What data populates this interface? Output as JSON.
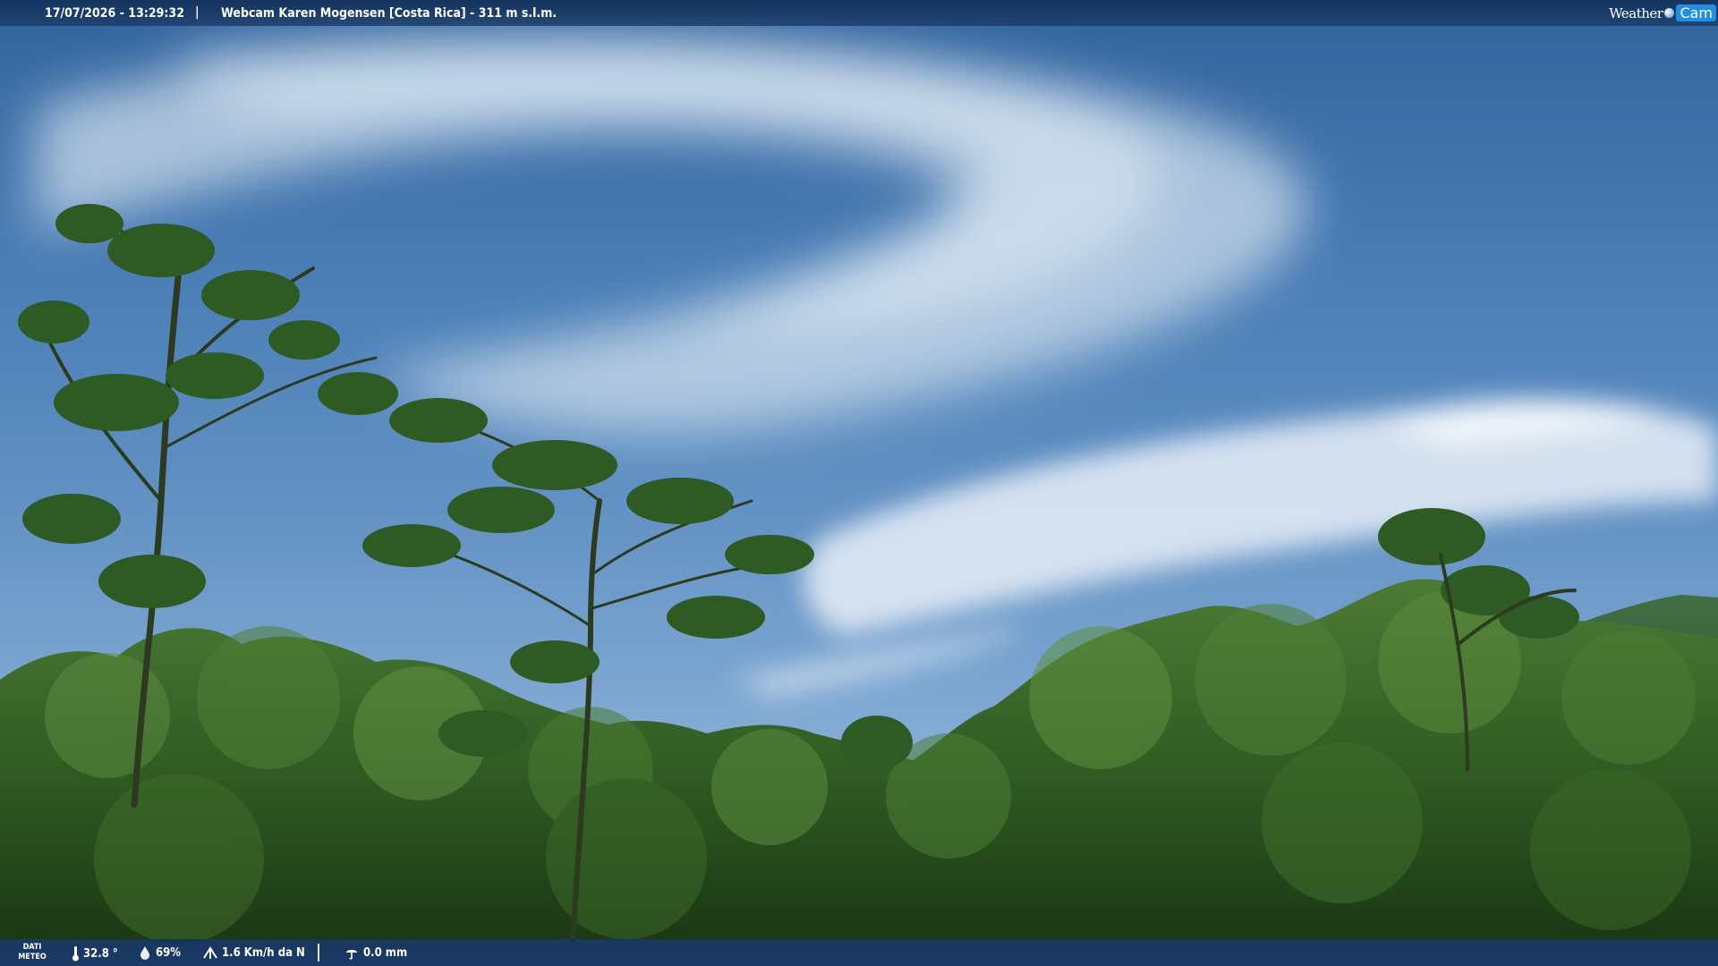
{
  "header": {
    "datetime": "17/07/2026 - 13:29:32",
    "separator": "|",
    "title": "Webcam Karen Mogensen [Costa Rica] - 311 m s.l.m.",
    "brand_left": "Weather",
    "brand_right": "Cam"
  },
  "footer": {
    "label_line1": "DATI",
    "label_line2": "METEO",
    "temperature": "32.8 °",
    "humidity": "69%",
    "wind": "1.6 Km/h da N",
    "rain": "0.0 mm"
  },
  "icons": {
    "temperature": "thermometer-icon",
    "humidity": "droplet-icon",
    "wind": "wind-vane-icon",
    "rain": "rain-gauge-icon",
    "brand": "weathercam-logo"
  },
  "colors": {
    "sky_top": "#32649d",
    "sky_bottom": "#9bbfe0",
    "foliage": "#2f5a22",
    "bar": "#173a68",
    "brand_accent": "#1f8fe6"
  }
}
